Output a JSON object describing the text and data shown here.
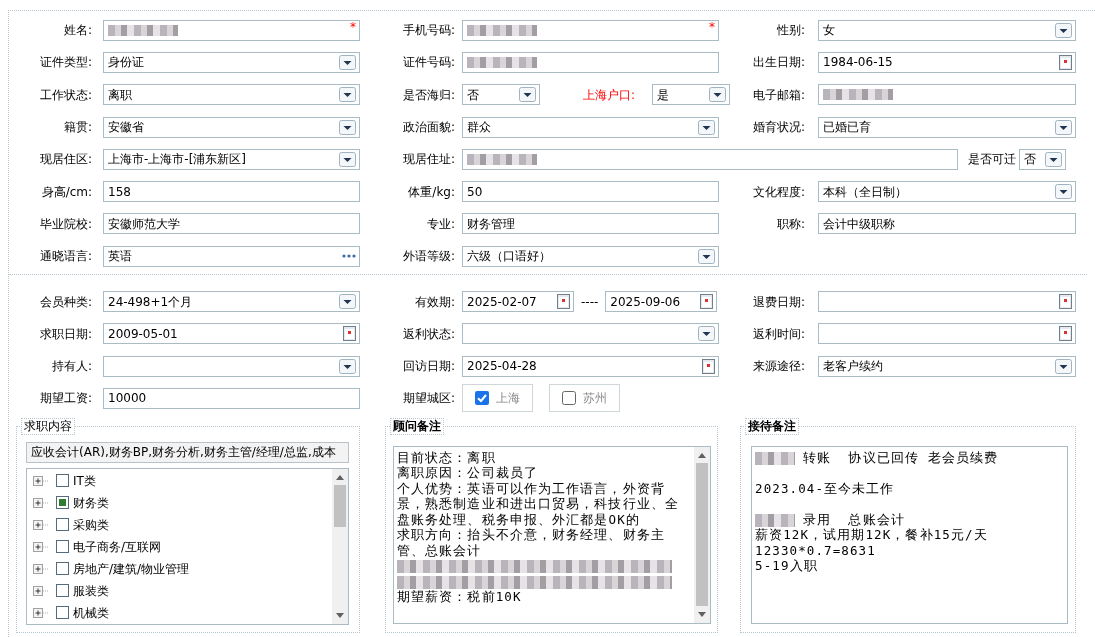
{
  "personal_rows": [
    [
      {
        "label": "姓名:",
        "control": {
          "kind": "text",
          "redacted": true,
          "required_mark": "*"
        }
      },
      {
        "label": "手机号码:",
        "control": {
          "kind": "text",
          "redacted": true,
          "required_mark": "*"
        }
      },
      {
        "label": "性别:",
        "control": {
          "kind": "select",
          "value": "女"
        }
      }
    ],
    [
      {
        "label": "证件类型:",
        "control": {
          "kind": "select",
          "value": "身份证"
        }
      },
      {
        "label": "证件号码:",
        "control": {
          "kind": "text",
          "redacted": true
        }
      },
      {
        "label": "出生日期:",
        "control": {
          "kind": "date",
          "value": "1984-06-15"
        }
      }
    ],
    [
      {
        "label": "工作状态:",
        "control": {
          "kind": "select",
          "value": "离职"
        }
      },
      {
        "label": "是否海归:",
        "control": {
          "kind": "select",
          "value": "否"
        },
        "extra": {
          "label": "上海户口:",
          "alert": true,
          "control": {
            "kind": "select",
            "value": "是"
          }
        }
      },
      {
        "label": "电子邮箱:",
        "control": {
          "kind": "text",
          "redacted": true
        }
      }
    ],
    [
      {
        "label": "籍贯:",
        "control": {
          "kind": "select",
          "value": "安徽省"
        }
      },
      {
        "label": "政治面貌:",
        "control": {
          "kind": "select",
          "value": "群众"
        }
      },
      {
        "label": "婚育状况:",
        "control": {
          "kind": "select",
          "value": "已婚已育"
        }
      }
    ],
    [
      {
        "label": "现居住区:",
        "control": {
          "kind": "select",
          "value": "上海市-上海市-[浦东新区]"
        }
      },
      {
        "label": "现居住址:",
        "wide": true,
        "control": {
          "kind": "text",
          "redacted": true
        },
        "extra": {
          "label": "是否可迁",
          "control": {
            "kind": "select",
            "value": "否"
          }
        }
      }
    ],
    [
      {
        "label": "身高/cm:",
        "control": {
          "kind": "text",
          "value": "158"
        }
      },
      {
        "label": "体重/kg:",
        "control": {
          "kind": "text",
          "value": "50"
        }
      },
      {
        "label": "文化程度:",
        "control": {
          "kind": "select",
          "value": "本科（全日制）"
        }
      }
    ],
    [
      {
        "label": "毕业院校:",
        "control": {
          "kind": "text",
          "value": "安徽师范大学"
        }
      },
      {
        "label": "专业:",
        "control": {
          "kind": "text",
          "value": "财务管理"
        }
      },
      {
        "label": "职称:",
        "control": {
          "kind": "text",
          "value": "会计中级职称"
        }
      }
    ],
    [
      {
        "label": "通晓语言:",
        "control": {
          "kind": "lookup",
          "value": "英语"
        }
      },
      {
        "label": "外语等级:",
        "control": {
          "kind": "select",
          "value": "六级（口语好）"
        }
      }
    ]
  ],
  "membership_rows": [
    [
      {
        "label": "会员种类:",
        "control": {
          "kind": "select",
          "value": "24-498+1个月"
        }
      },
      {
        "label": "有效期:",
        "control": {
          "kind": "date_range",
          "values": [
            "2025-02-07",
            "2025-09-06"
          ],
          "separator": "----"
        }
      },
      {
        "label": "退费日期:",
        "control": {
          "kind": "date"
        }
      }
    ],
    [
      {
        "label": "求职日期:",
        "control": {
          "kind": "date",
          "value": "2009-05-01"
        }
      },
      {
        "label": "返利状态:",
        "control": {
          "kind": "select"
        }
      },
      {
        "label": "返利时间:",
        "control": {
          "kind": "date"
        }
      }
    ],
    [
      {
        "label": "持有人:",
        "control": {
          "kind": "select"
        }
      },
      {
        "label": "回访日期:",
        "control": {
          "kind": "date",
          "value": "2025-04-28"
        }
      },
      {
        "label": "来源途径:",
        "control": {
          "kind": "select",
          "value": "老客户续约"
        }
      }
    ],
    [
      {
        "label": "期望工资:",
        "control": {
          "kind": "text",
          "value": "10000"
        }
      },
      {
        "label": "期望城区:",
        "control": {
          "kind": "checkboxes",
          "options": [
            {
              "label": "上海",
              "checked": true
            },
            {
              "label": "苏州",
              "checked": false
            }
          ]
        }
      }
    ]
  ],
  "job_content": {
    "title": "求职内容",
    "summary": "应收会计(AR),财务BP,财务分析,财务主管/经理/总监,成本",
    "categories": [
      {
        "label": "IT类",
        "partial": false
      },
      {
        "label": "财务类",
        "partial": true
      },
      {
        "label": "采购类",
        "partial": false
      },
      {
        "label": "电子商务/互联网",
        "partial": false
      },
      {
        "label": "房地产/建筑/物业管理",
        "partial": false
      },
      {
        "label": "服装类",
        "partial": false
      },
      {
        "label": "机械类",
        "partial": false
      }
    ]
  },
  "consultant_notes": {
    "title": "顾问备注",
    "lines": [
      {
        "kind": "text",
        "text": "目前状态：离职"
      },
      {
        "kind": "text",
        "text": "离职原因：公司裁员了"
      },
      {
        "kind": "text",
        "text": "个人优势：英语可以作为工作语言，外资背"
      },
      {
        "kind": "text",
        "text": "景，熟悉制造业和进出口贸易，科技行业、全"
      },
      {
        "kind": "text",
        "text": "盘账务处理、税务申报、外汇都是OK的"
      },
      {
        "kind": "text",
        "text": "求职方向：抬头不介意，财务经理、财务主"
      },
      {
        "kind": "text",
        "text": "管、总账会计"
      },
      {
        "kind": "redacted"
      },
      {
        "kind": "redacted"
      },
      {
        "kind": "text",
        "text": "期望薪资：税前10K"
      }
    ]
  },
  "reception_notes": {
    "title": "接待备注",
    "lines": [
      {
        "kind": "redacted_prefix",
        "text": "转账  协议已回传 老会员续费"
      },
      {
        "kind": "blank"
      },
      {
        "kind": "text",
        "text": "2023.04-至今未工作"
      },
      {
        "kind": "blank"
      },
      {
        "kind": "redacted_prefix",
        "text": "录用  总账会计"
      },
      {
        "kind": "text",
        "text": "薪资12K，试用期12K，餐补15元/天"
      },
      {
        "kind": "text",
        "text": "12330*0.7=8631"
      },
      {
        "kind": "text",
        "text": "5-19入职"
      }
    ]
  }
}
